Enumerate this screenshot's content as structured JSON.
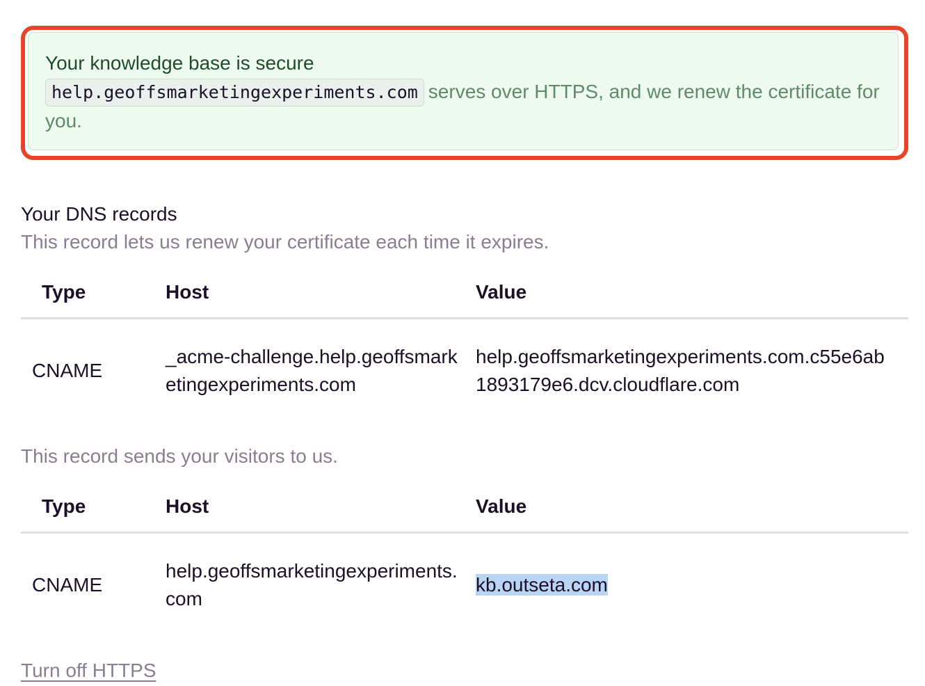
{
  "banner": {
    "title": "Your knowledge base is secure",
    "domain": "help.geoffsmarketingexperiments.com",
    "message": "serves over HTTPS, and we renew the certificate for you."
  },
  "dns": {
    "title": "Your DNS records",
    "tables": [
      {
        "description": "This record lets us renew your certificate each time it expires.",
        "headers": {
          "type": "Type",
          "host": "Host",
          "value": "Value"
        },
        "row": {
          "type": "CNAME",
          "host": "_acme-challenge.help.geoffsmarketingexperiments.com",
          "value": "help.geoffsmarketingexperiments.com.c55e6ab1893179e6.dcv.cloudflare.com"
        }
      },
      {
        "description": "This record sends your visitors to us.",
        "headers": {
          "type": "Type",
          "host": "Host",
          "value": "Value"
        },
        "row": {
          "type": "CNAME",
          "host": "help.geoffsmarketingexperiments.com",
          "value": "kb.outseta.com"
        }
      }
    ]
  },
  "actions": {
    "turn_off_https": "Turn off HTTPS"
  },
  "colors": {
    "banner_bg": "#eefaf0",
    "highlight_border": "#e8442a",
    "selection": "#b9d4f5"
  }
}
